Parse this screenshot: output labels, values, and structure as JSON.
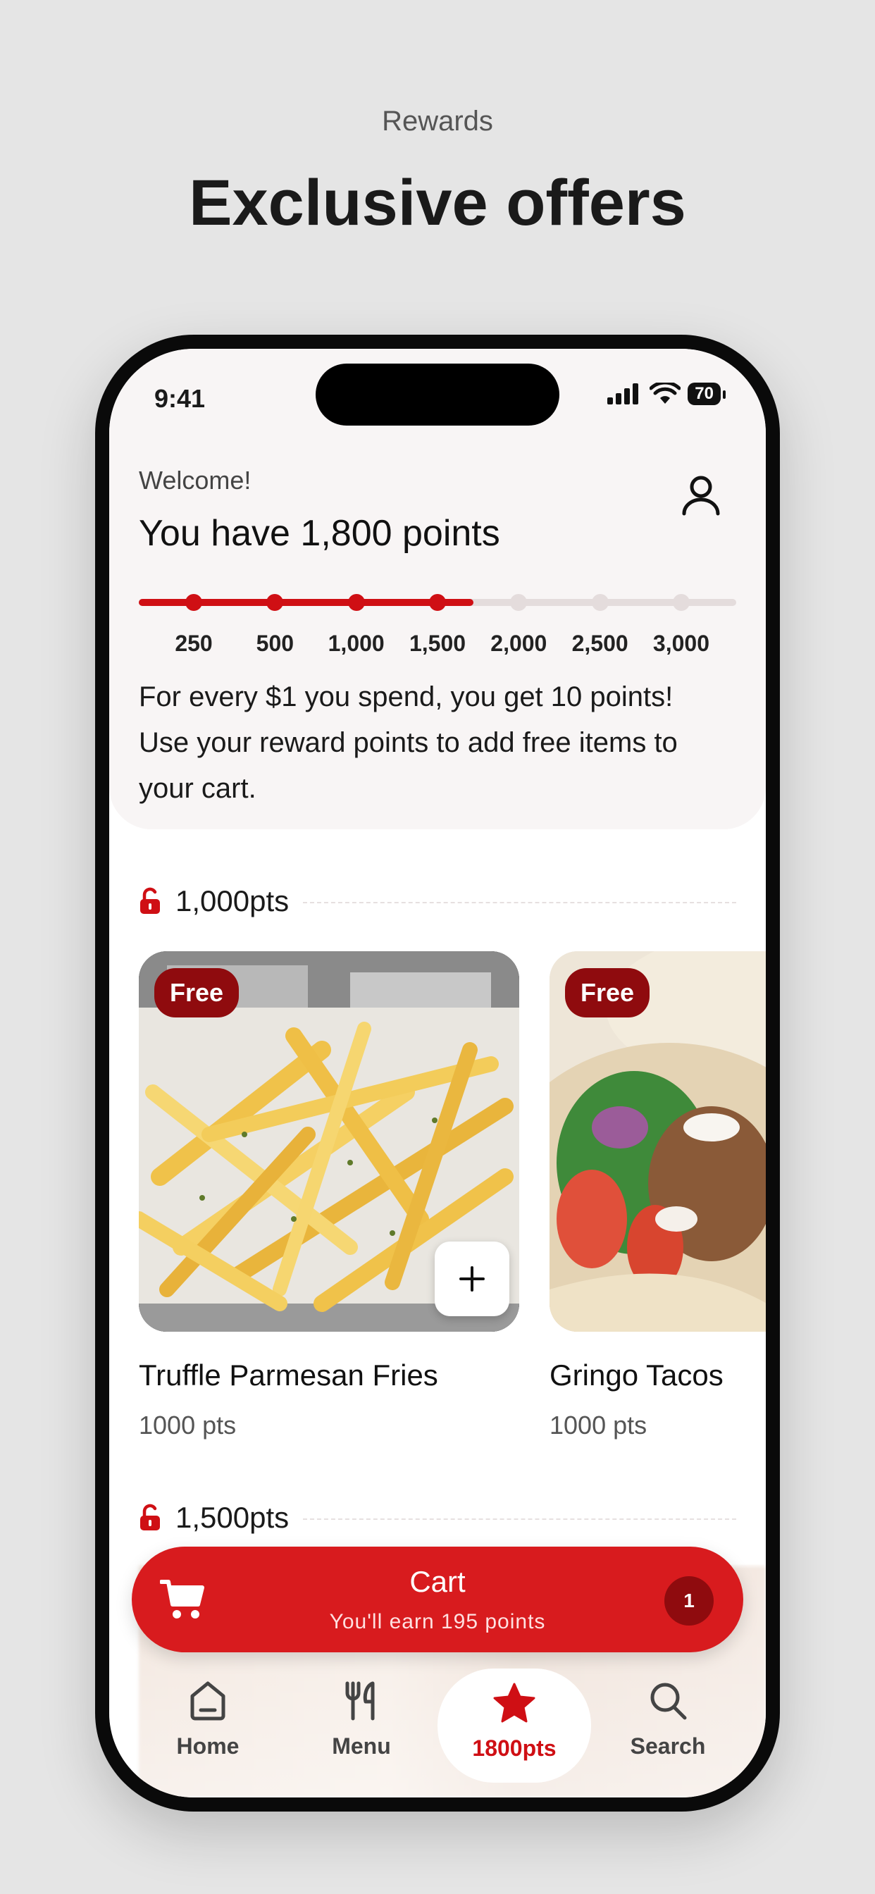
{
  "header": {
    "category": "Rewards",
    "title": "Exclusive offers"
  },
  "status_bar": {
    "time": "9:41",
    "battery": "70"
  },
  "rewards": {
    "welcome": "Welcome!",
    "points_title": "You have 1,800 points",
    "progress_fraction": 0.56,
    "milestones": [
      "250",
      "500",
      "1,000",
      "1,500",
      "2,000",
      "2,500",
      "3,000"
    ],
    "milestones_reached": 4,
    "info_line1": "For every $1 you spend, you get 10 points!",
    "info_line2": "Use your reward points to add free items to",
    "info_line3": "your cart."
  },
  "tiers": [
    {
      "label": "1,000pts",
      "items": [
        {
          "badge": "Free",
          "name": "Truffle Parmesan Fries",
          "points": "1000 pts"
        },
        {
          "badge": "Free",
          "name": "Gringo Tacos",
          "points": "1000 pts"
        }
      ]
    },
    {
      "label": "1,500pts"
    }
  ],
  "cart": {
    "title": "Cart",
    "subtitle": "You'll earn 195 points",
    "count": "1"
  },
  "nav": {
    "home": "Home",
    "menu": "Menu",
    "rewards": "1800pts",
    "search": "Search"
  },
  "colors": {
    "accent": "#cf0f14",
    "badge": "#8f0b0e",
    "background": "#e5e5e5"
  }
}
